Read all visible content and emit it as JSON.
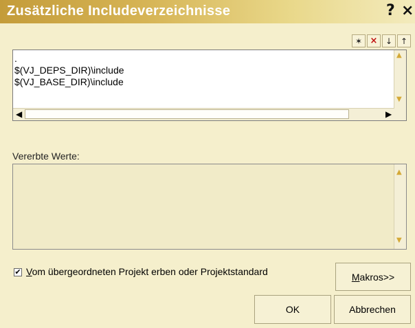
{
  "window": {
    "title": "Zusätzliche Includeverzeichnisse",
    "help_glyph": "?",
    "close_glyph": "×"
  },
  "toolbar": {
    "new_glyph": "✶",
    "delete_glyph": "×",
    "down_glyph": "↓",
    "up_glyph": "↑"
  },
  "list": {
    "items": [
      ".",
      "$(VJ_DEPS_DIR)\\include",
      "$(VJ_BASE_DIR)\\include"
    ]
  },
  "inherited": {
    "label": "Vererbte Werte:"
  },
  "inherit_checkbox": {
    "checked": true,
    "mark": "✔",
    "label_first": "V",
    "label_rest": "om übergeordneten Projekt erben oder Projektstandard"
  },
  "buttons": {
    "makros_first": "M",
    "makros_rest": "akros>>",
    "ok": "OK",
    "cancel": "Abbrechen"
  }
}
